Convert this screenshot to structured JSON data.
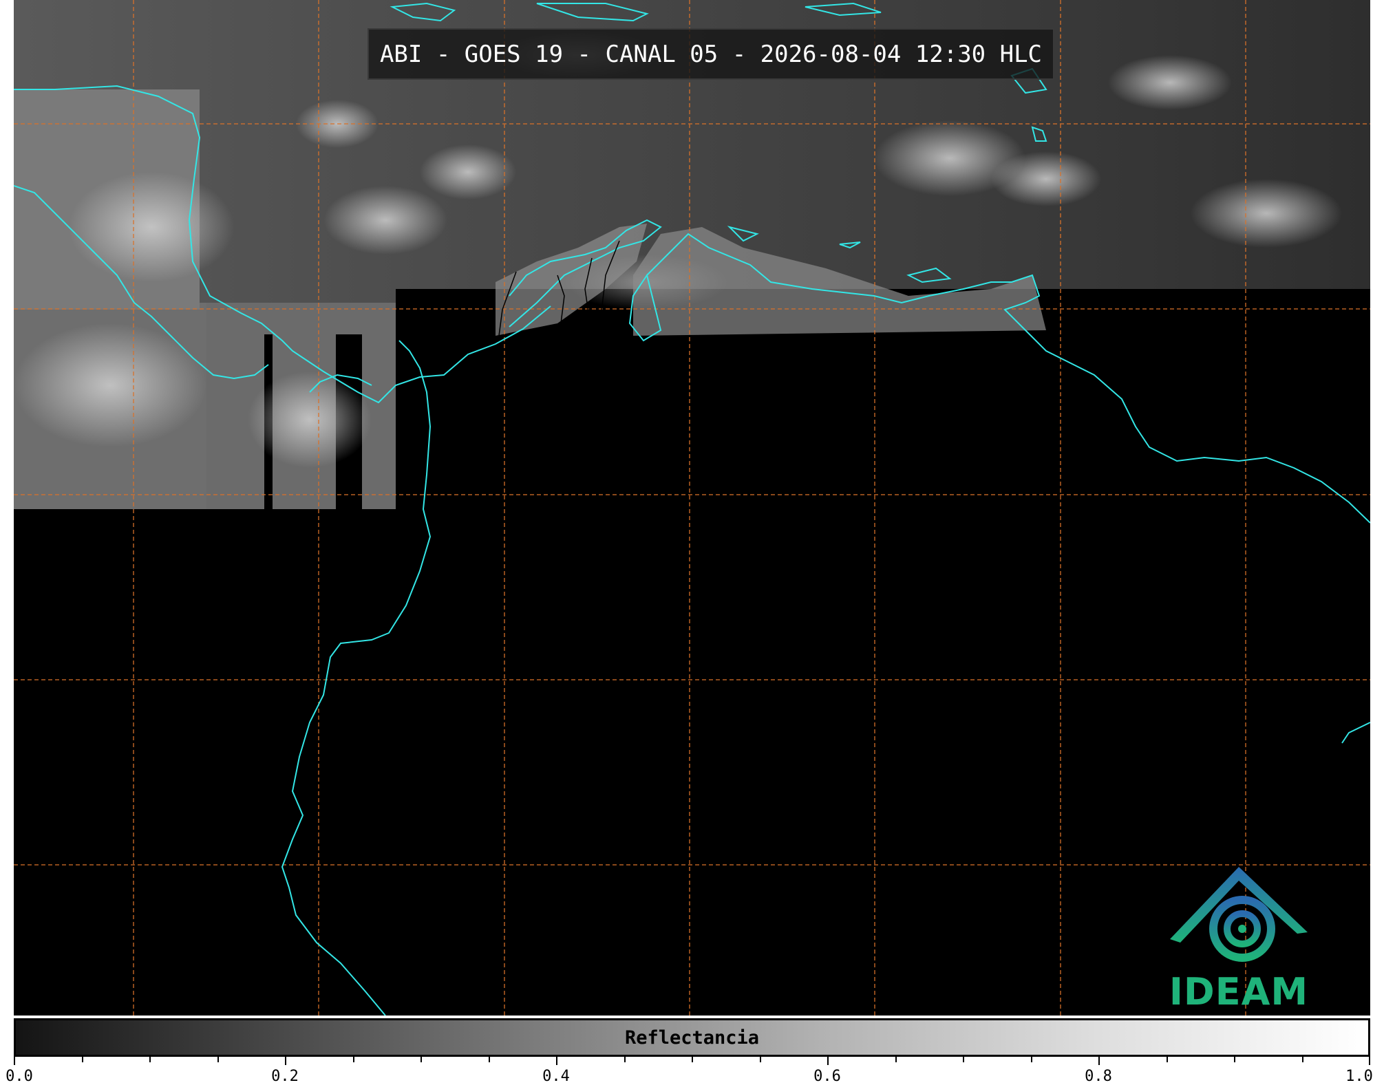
{
  "title": "ABI - GOES 19 - CANAL 05 - 2026-08-04 12:30 HLC",
  "colorbar": {
    "label": "Reflectancia",
    "ticks": [
      "0.0",
      "0.2",
      "0.4",
      "0.6",
      "0.8",
      "1.0"
    ],
    "gradient_colors": [
      "#141414",
      "#808080",
      "#ffffff"
    ]
  },
  "logo": {
    "text": "IDEAM"
  },
  "colors": {
    "coastline": "#33e6e6",
    "gridline": "#d9722a",
    "background": "#000000",
    "logo_text": "#1fb37a"
  },
  "icons": [
    "ideam-logo-icon"
  ]
}
